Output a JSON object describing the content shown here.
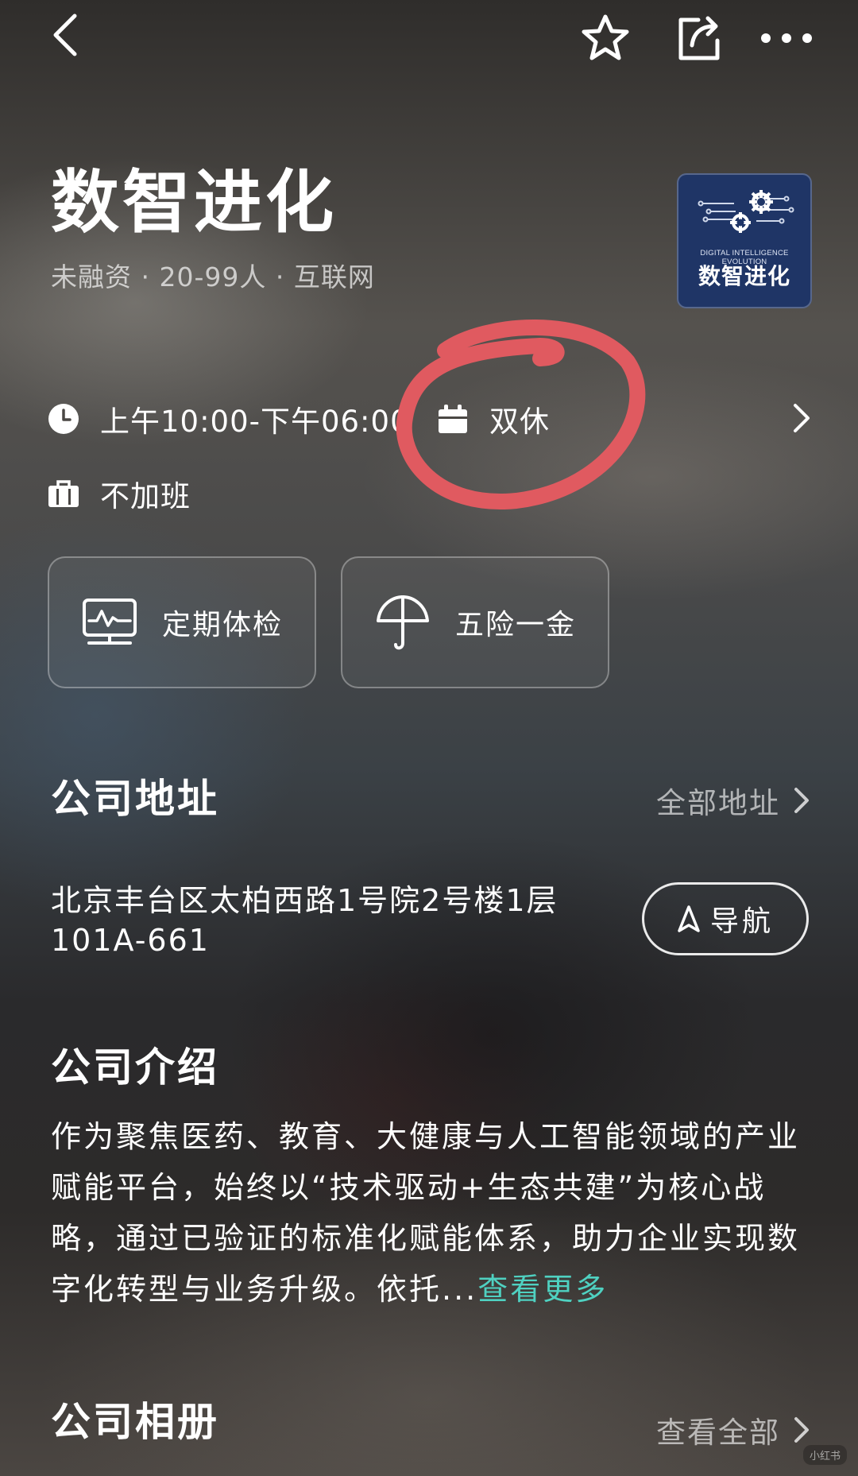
{
  "top_bar": {
    "back_icon": "chevron-left-icon",
    "favorite_icon": "star-icon",
    "share_icon": "share-icon",
    "more_icon": "more-dots-icon"
  },
  "company": {
    "name": "数智进化",
    "meta": "未融资 · 20-99人 · 互联网",
    "logo": {
      "subtitle_en": "DIGITAL INTELLIGENCE EVOLUTION",
      "name_cn": "数智进化"
    }
  },
  "work_info": {
    "hours": "上午10:00-下午06:00",
    "rest": "双休",
    "overtime": "不加班",
    "highlight_color": "#e05a60"
  },
  "benefits": [
    {
      "label": "定期体检",
      "icon": "health-monitor-icon"
    },
    {
      "label": "五险一金",
      "icon": "umbrella-icon"
    }
  ],
  "address": {
    "title": "公司地址",
    "all_link": "全部地址",
    "text": "北京丰台区太柏西路1号院2号楼1层101A-661",
    "nav_button": "导航"
  },
  "intro": {
    "title": "公司介绍",
    "text": "作为聚焦医药、教育、大健康与人工智能领域的产业赋能平台，始终以“技术驱动+生态共建”为核心战略，通过已验证的标准化赋能体系，助力企业实现数字化转型与业务升级。依托...",
    "more_link": "查看更多",
    "accent_color": "#4fd1c1"
  },
  "album": {
    "title": "公司相册",
    "view_all": "查看全部"
  },
  "watermark": "小红书"
}
